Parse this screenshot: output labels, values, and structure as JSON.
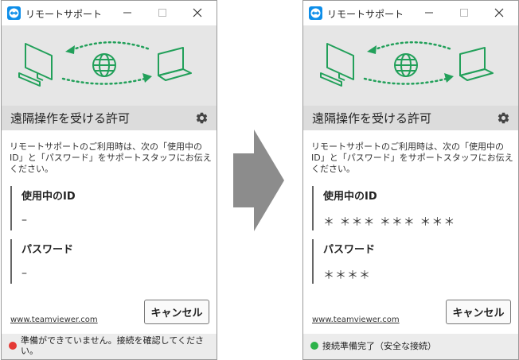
{
  "colors": {
    "accent_green": "#22a05a",
    "status_error": "#e53935",
    "status_ok": "#2db34a",
    "arrow_gray": "#8c8c8c"
  },
  "icons": {
    "app": "teamviewer-logo-icon",
    "settings": "gear-icon",
    "illustration": [
      "desktop-computer-icon",
      "globe-icon",
      "laptop-icon"
    ],
    "transition": "right-arrow-icon"
  },
  "windows": [
    {
      "title": "リモートサポート",
      "heading": "遠隔操作を受ける許可",
      "description": "リモートサポートのご利用時は、次の「使用中のID」と「パスワード」をサポートスタッフにお伝えください。",
      "id_label": "使用中のID",
      "id_value": "–",
      "password_label": "パスワード",
      "password_value": "–",
      "link": "www.teamviewer.com",
      "cancel_label": "キャンセル",
      "status_text": "準備ができていません。接続を確認してください。"
    },
    {
      "title": "リモートサポート",
      "heading": "遠隔操作を受ける許可",
      "description": "リモートサポートのご利用時は、次の「使用中のID」と「パスワード」をサポートスタッフにお伝えください。",
      "id_label": "使用中のID",
      "id_value": "＊ ＊＊＊ ＊＊＊ ＊＊＊",
      "password_label": "パスワード",
      "password_value": "＊＊＊＊",
      "link": "www.teamviewer.com",
      "cancel_label": "キャンセル",
      "status_text": "接続準備完了（安全な接続）"
    }
  ]
}
